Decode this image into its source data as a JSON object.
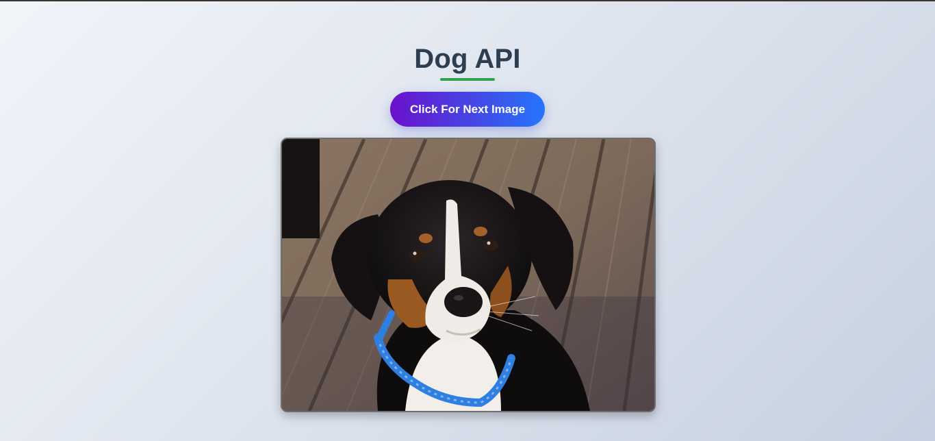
{
  "header": {
    "title": "Dog API"
  },
  "controls": {
    "next_button_label": "Click For Next Image"
  },
  "image": {
    "alt": "Dog",
    "subject": "dog-photo"
  },
  "colors": {
    "title": "#2c3e50",
    "underline": "#2ea44f",
    "button_gradient_start": "#6a11cb",
    "button_gradient_end": "#2575fc"
  }
}
